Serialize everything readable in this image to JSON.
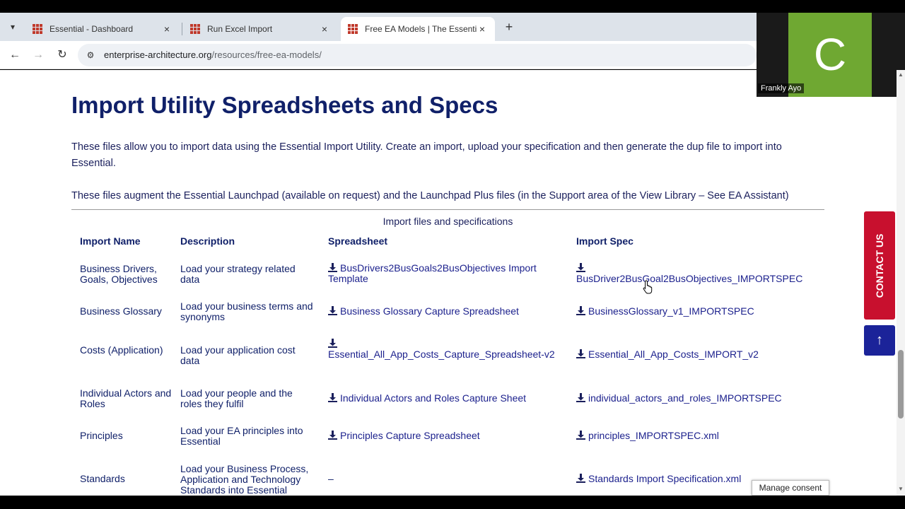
{
  "browser": {
    "tabs": [
      {
        "label": "Essential - Dashboard",
        "close": "×"
      },
      {
        "label": "Run Excel Import",
        "close": "×"
      },
      {
        "label": "Free EA Models | The Essential P",
        "close": "×"
      }
    ],
    "new_tab": "+",
    "url_domain": "enterprise-architecture.org",
    "url_path": "/resources/free-ea-models/"
  },
  "video": {
    "initial": "C",
    "name": "Frankly Ayo"
  },
  "page": {
    "heading": "Import Utility Spreadsheets and Specs",
    "para1": "These files allow you to import data using the Essential Import Utility. Create an import, upload your specification and then generate the dup file to import into Essential.",
    "para2": "These files augment the Essential Launchpad (available on request) and the Launchpad Plus files (in the Support area of the View Library – See EA Assistant)",
    "table_caption": "Import files and specifications",
    "headers": [
      "Import Name",
      "Description",
      "Spreadsheet",
      "Import Spec"
    ],
    "rows": [
      {
        "name": "Business Drivers, Goals, Objectives",
        "description": "Load your strategy related data",
        "spreadsheet": "BusDrivers2BusGoals2BusObjectives Import Template",
        "spec": "BusDriver2BusGoal2BusObjectives_IMPORTSPEC"
      },
      {
        "name": "Business Glossary",
        "description": "Load your business terms and synonyms",
        "spreadsheet": "Business Glossary Capture Spreadsheet",
        "spec": "BusinessGlossary_v1_IMPORTSPEC"
      },
      {
        "name": "Costs (Application)",
        "description": "Load your application cost data",
        "spreadsheet": "Essential_All_App_Costs_Capture_Spreadsheet-v2",
        "spec": "Essential_All_App_Costs_IMPORT_v2"
      },
      {
        "name": "Individual Actors and Roles",
        "description": "Load your people and the roles they fulfil",
        "spreadsheet": "Individual Actors and Roles Capture Sheet",
        "spec": "individual_actors_and_roles_IMPORTSPEC"
      },
      {
        "name": "Principles",
        "description": "Load your EA principles into Essential",
        "spreadsheet": "Principles Capture Spreadsheet",
        "spec": "principles_IMPORTSPEC.xml"
      },
      {
        "name": "Standards",
        "description": "Load your Business Process, Application and Technology Standards into Essential",
        "spreadsheet": "–",
        "spec": "Standards Import Specification.xml"
      }
    ]
  },
  "contact_label": "CONTACT US",
  "consent_label": "Manage consent",
  "colors": {
    "heading": "#102069",
    "contact": "#c8102e",
    "to_top": "#1b2399"
  }
}
